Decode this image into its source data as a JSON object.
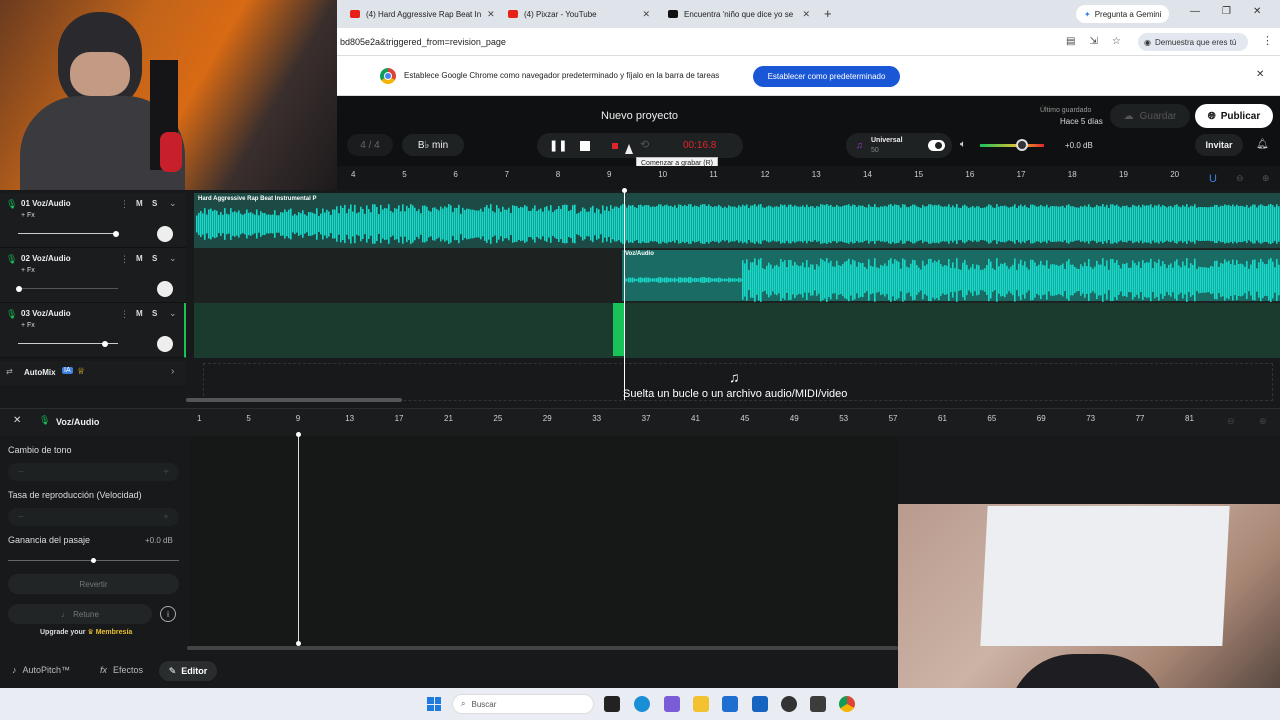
{
  "browser": {
    "tabs": [
      {
        "label": "(4) Hard Aggressive Rap Beat In"
      },
      {
        "label": "(4) Pixzar - YouTube"
      },
      {
        "label": "Encuentra 'niño que dice yo se"
      }
    ],
    "new_tab": "+",
    "gemini": "Pregunta a Gemini",
    "url": "bd805e2a&triggered_from=revision_page",
    "profile": "Demuestra que eres tú",
    "infobar_text": "Establece Google Chrome como navegador predeterminado y fíjalo en la barra de tareas",
    "infobar_button": "Establecer como predeterminado"
  },
  "header": {
    "project_title": "Nuevo proyecto",
    "last_saved_label": "Último guardado",
    "last_saved_time": "Hace 5 días",
    "save": "Guardar",
    "publish": "Publicar",
    "invite": "Invitar"
  },
  "transport": {
    "time_sig": "4 / 4",
    "key": "B♭ min",
    "time": "00:16.8",
    "tooltip": "Comenzar a grabar (R)",
    "preset_name": "Universal",
    "preset_value": "50",
    "volume_db": "+0.0 dB"
  },
  "timeline": {
    "bars": [
      "4",
      "5",
      "6",
      "7",
      "8",
      "9",
      "10",
      "11",
      "12",
      "13",
      "14",
      "15",
      "16",
      "17",
      "18",
      "19",
      "20"
    ]
  },
  "tracks": [
    {
      "title": "01  Voz/Audio",
      "fx": "+ Fx",
      "m": "M",
      "s": "S",
      "clip": "Hard Aggressive Rap Beat Instrumental  P"
    },
    {
      "title": "02  Voz/Audio",
      "fx": "+ Fx",
      "m": "M",
      "s": "S",
      "clip": "Voz/Audio"
    },
    {
      "title": "03  Voz/Audio",
      "fx": "+ Fx",
      "m": "M",
      "s": "S",
      "clip": ""
    }
  ],
  "automix": {
    "label": "AutoMix",
    "badge": "IA"
  },
  "drop_hint": "Suelta un bucle o un archivo audio/MIDI/video",
  "editor": {
    "track_name": "Voz/Audio",
    "pitch_label": "Cambio de tono",
    "rate_label": "Tasa de reproducción (Velocidad)",
    "gain_label": "Ganancia del pasaje",
    "gain_value": "+0.0 dB",
    "revert": "Revertir",
    "retune": "Retune",
    "upgrade_prefix": "Upgrade your",
    "upgrade_link": "Membresía",
    "ruler": [
      "1",
      "5",
      "9",
      "13",
      "17",
      "21",
      "25",
      "29",
      "33",
      "37",
      "41",
      "45",
      "49",
      "53",
      "57",
      "61",
      "65",
      "69",
      "73",
      "77",
      "81"
    ]
  },
  "bottom_tabs": [
    {
      "label": "AutoPitch™"
    },
    {
      "label": "Efectos"
    },
    {
      "label": "Editor"
    }
  ],
  "taskbar": {
    "search_placeholder": "Buscar"
  },
  "colors": {
    "accent": "#16d9c9",
    "record": "#e0242b",
    "brand_blue": "#1a57d6"
  }
}
